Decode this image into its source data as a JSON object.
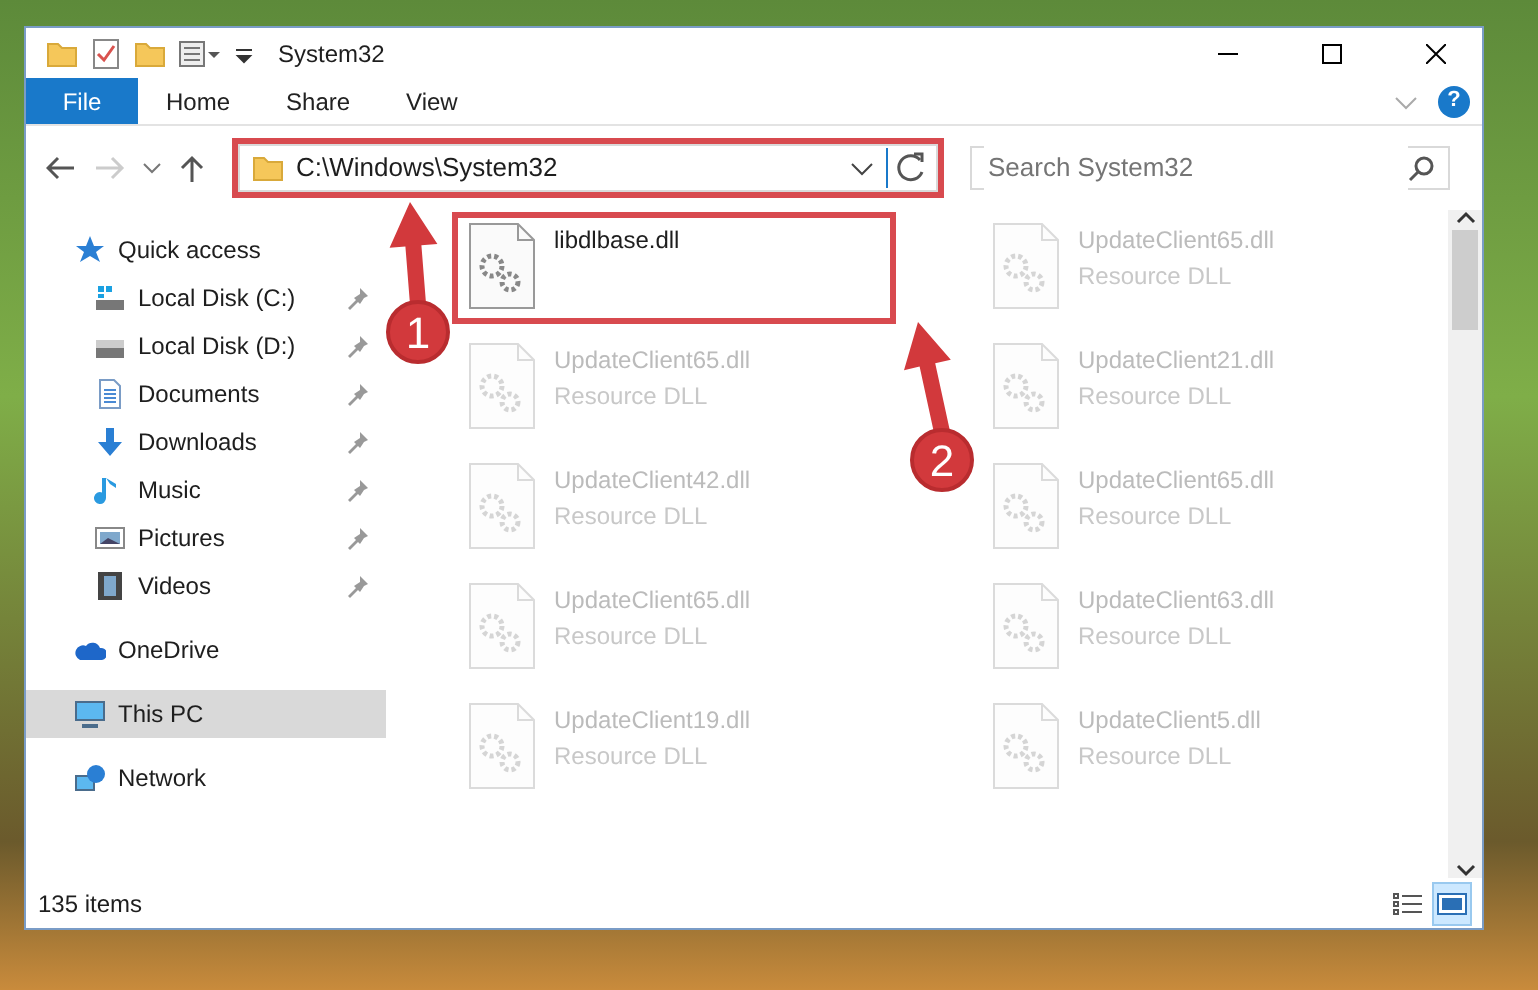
{
  "window": {
    "title": "System32"
  },
  "ribbon": {
    "tabs": [
      {
        "label": "File",
        "kind": "file"
      },
      {
        "label": "Home",
        "kind": "tab"
      },
      {
        "label": "Share",
        "kind": "tab"
      },
      {
        "label": "View",
        "kind": "tab"
      }
    ],
    "help": "?"
  },
  "address_bar": {
    "path": "C:\\Windows\\System32",
    "highlighted": true
  },
  "search": {
    "placeholder": "Search System32"
  },
  "sidebar": {
    "items": [
      {
        "label": "Quick access",
        "kind": "star",
        "selected": false,
        "children": [
          {
            "label": "Local Disk (C:)",
            "kind": "system-drive",
            "pinned": true,
            "selected": false
          },
          {
            "label": "Local Disk (D:)",
            "kind": "drive",
            "pinned": true,
            "selected": false
          },
          {
            "label": "Documents",
            "kind": "documents",
            "pinned": true,
            "selected": false
          },
          {
            "label": "Downloads",
            "kind": "downloads",
            "pinned": true,
            "selected": false
          },
          {
            "label": "Music",
            "kind": "music",
            "pinned": true,
            "selected": false
          },
          {
            "label": "Pictures",
            "kind": "pictures",
            "pinned": true,
            "selected": false
          },
          {
            "label": "Videos",
            "kind": "videos",
            "pinned": true,
            "selected": false
          }
        ]
      },
      {
        "label": "OneDrive",
        "kind": "cloud",
        "selected": false
      },
      {
        "label": "This PC",
        "kind": "computer",
        "selected": true
      },
      {
        "label": "Network",
        "kind": "network",
        "selected": false
      }
    ]
  },
  "files": [
    {
      "name": "libdlbase.dll",
      "faded": false,
      "highlighted": true
    },
    {
      "name": "UpdateClient65.dll",
      "type": "Resource DLL",
      "faded": true,
      "highlighted": false
    },
    {
      "name": "UpdateClient65.dll",
      "type": "Resource DLL",
      "faded": true,
      "highlighted": false
    },
    {
      "name": "UpdateClient21.dll",
      "type": "Resource DLL",
      "faded": true,
      "highlighted": false
    },
    {
      "name": "UpdateClient42.dll",
      "type": "Resource DLL",
      "faded": true,
      "highlighted": false
    },
    {
      "name": "UpdateClient65.dll",
      "type": "Resource DLL",
      "faded": true,
      "highlighted": false
    },
    {
      "name": "UpdateClient65.dll",
      "type": "Resource DLL",
      "faded": true,
      "highlighted": false
    },
    {
      "name": "UpdateClient63.dll",
      "type": "Resource DLL",
      "faded": true,
      "highlighted": false
    },
    {
      "name": "UpdateClient19.dll",
      "type": "Resource DLL",
      "faded": true,
      "highlighted": false
    },
    {
      "name": "UpdateClient5.dll",
      "type": "Resource DLL",
      "faded": true,
      "highlighted": false
    }
  ],
  "status_bar": {
    "count": "135 items",
    "views": [
      {
        "kind": "details",
        "selected": false
      },
      {
        "kind": "large-icons",
        "selected": true
      }
    ]
  },
  "annotations": [
    {
      "label": "1"
    },
    {
      "label": "2"
    }
  ]
}
